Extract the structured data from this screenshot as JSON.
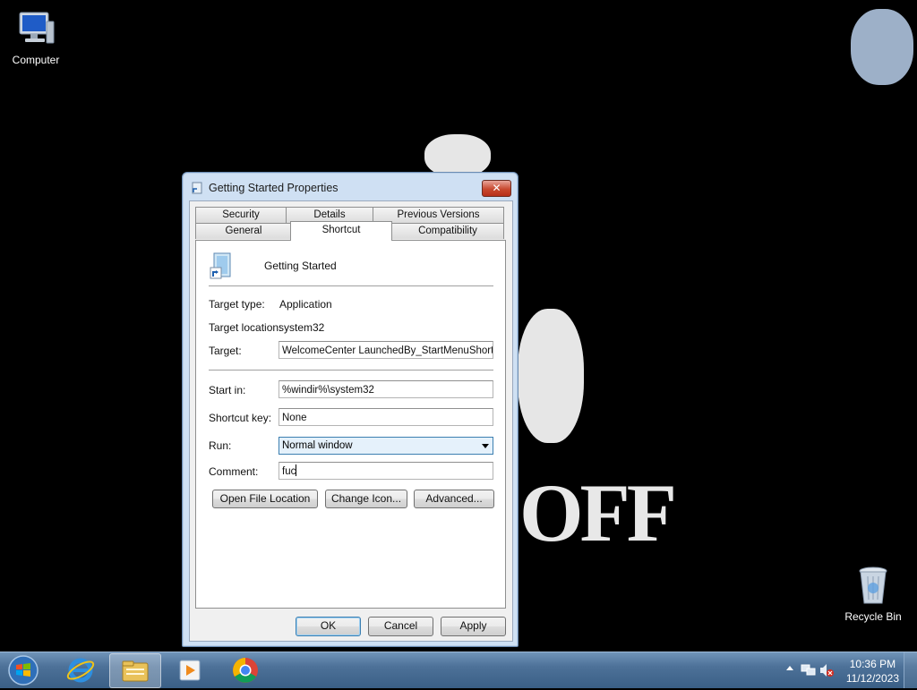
{
  "desktop": {
    "icons": [
      {
        "label": "Computer",
        "icon": "computer-icon"
      },
      {
        "label": "Recycle Bin",
        "icon": "recycle-bin-icon"
      }
    ],
    "wallpaper_text": "OFF"
  },
  "dialog": {
    "title": "Getting Started Properties",
    "close": "✕",
    "tabs_row1": [
      "Security",
      "Details",
      "Previous Versions"
    ],
    "tabs_row2": [
      "General",
      "Shortcut",
      "Compatibility"
    ],
    "active_tab": "Shortcut",
    "shortcut_name": "Getting Started",
    "target_type_label": "Target type:",
    "target_type": "Application",
    "target_location_label": "Target location:",
    "target_location": "system32",
    "target_label": "Target:",
    "target": "WelcomeCenter LaunchedBy_StartMenuShortcut",
    "start_in_label": "Start in:",
    "start_in": "%windir%\\system32",
    "shortcut_key_label": "Shortcut key:",
    "shortcut_key": "None",
    "run_label": "Run:",
    "run": "Normal window",
    "comment_label": "Comment:",
    "comment": "fuc",
    "buttons": {
      "open_file_location": "Open File Location",
      "change_icon": "Change Icon...",
      "advanced": "Advanced...",
      "ok": "OK",
      "cancel": "Cancel",
      "apply": "Apply"
    }
  },
  "taskbar": {
    "pinned": [
      "windows-start-icon",
      "internet-explorer-icon",
      "file-explorer-icon",
      "media-player-icon",
      "chrome-icon"
    ],
    "clock_time": "10:36 PM",
    "clock_date": "11/12/2023"
  }
}
